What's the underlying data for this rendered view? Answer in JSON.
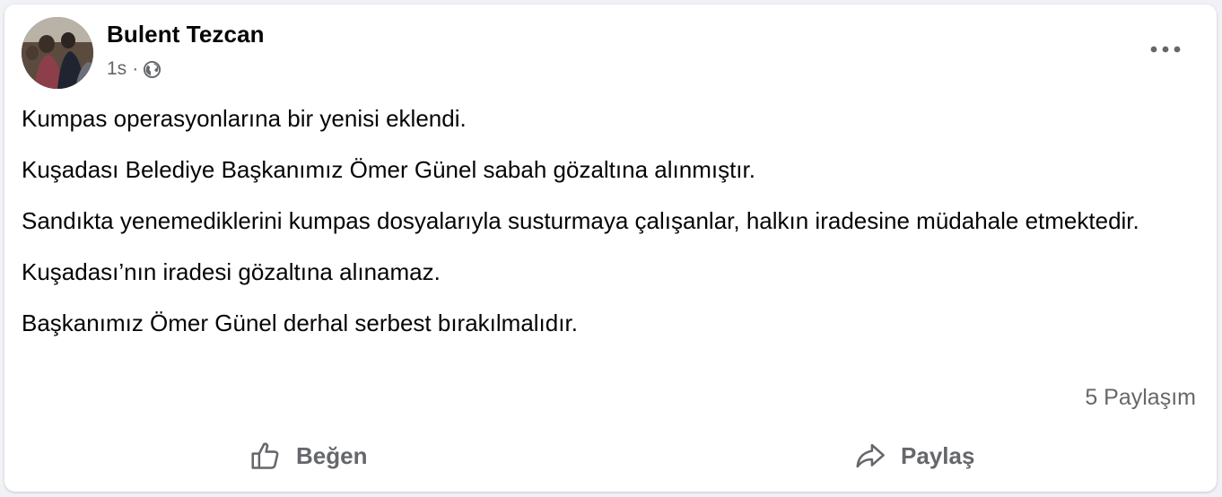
{
  "post": {
    "author": "Bulent Tezcan",
    "time": "1s",
    "separator": "·",
    "privacy_icon": "globe-icon",
    "more_icon": "more-dots-icon",
    "paragraphs": [
      "Kumpas operasyonlarına bir yenisi eklendi.",
      "Kuşadası Belediye Başkanımız Ömer Günel sabah gözaltına alınmıştır.",
      "Sandıkta yenemediklerini kumpas dosyalarıyla susturmaya çalışanlar, halkın iradesine müdahale etmektedir.",
      "Kuşadası’nın iradesi gözaltına alınamaz.",
      "Başkanımız Ömer Günel derhal serbest bırakılmalıdır."
    ],
    "share_count": "5 Paylaşım"
  },
  "actions": {
    "like_label": "Beğen",
    "like_icon": "thumbs-up-icon",
    "share_label": "Paylaş",
    "share_icon": "share-arrow-icon"
  },
  "colors": {
    "text": "#050505",
    "secondary_text": "#65676b",
    "background": "#f0f2f5",
    "card": "#ffffff"
  }
}
